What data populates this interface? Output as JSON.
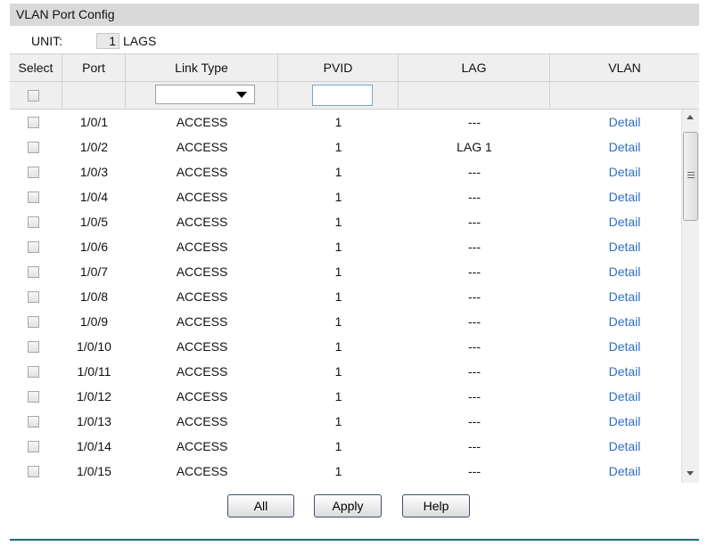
{
  "panel": {
    "title": "VLAN Port Config"
  },
  "unit": {
    "label": "UNIT:",
    "value": "1",
    "lags_label": "LAGS"
  },
  "columns": {
    "select": "Select",
    "port": "Port",
    "link_type": "Link Type",
    "pvid": "PVID",
    "lag": "LAG",
    "vlan": "VLAN"
  },
  "filter": {
    "link_type_value": "",
    "pvid_value": ""
  },
  "rows": [
    {
      "port": "1/0/1",
      "link_type": "ACCESS",
      "pvid": "1",
      "lag": "---",
      "vlan": "Detail"
    },
    {
      "port": "1/0/2",
      "link_type": "ACCESS",
      "pvid": "1",
      "lag": "LAG 1",
      "vlan": "Detail"
    },
    {
      "port": "1/0/3",
      "link_type": "ACCESS",
      "pvid": "1",
      "lag": "---",
      "vlan": "Detail"
    },
    {
      "port": "1/0/4",
      "link_type": "ACCESS",
      "pvid": "1",
      "lag": "---",
      "vlan": "Detail"
    },
    {
      "port": "1/0/5",
      "link_type": "ACCESS",
      "pvid": "1",
      "lag": "---",
      "vlan": "Detail"
    },
    {
      "port": "1/0/6",
      "link_type": "ACCESS",
      "pvid": "1",
      "lag": "---",
      "vlan": "Detail"
    },
    {
      "port": "1/0/7",
      "link_type": "ACCESS",
      "pvid": "1",
      "lag": "---",
      "vlan": "Detail"
    },
    {
      "port": "1/0/8",
      "link_type": "ACCESS",
      "pvid": "1",
      "lag": "---",
      "vlan": "Detail"
    },
    {
      "port": "1/0/9",
      "link_type": "ACCESS",
      "pvid": "1",
      "lag": "---",
      "vlan": "Detail"
    },
    {
      "port": "1/0/10",
      "link_type": "ACCESS",
      "pvid": "1",
      "lag": "---",
      "vlan": "Detail"
    },
    {
      "port": "1/0/11",
      "link_type": "ACCESS",
      "pvid": "1",
      "lag": "---",
      "vlan": "Detail"
    },
    {
      "port": "1/0/12",
      "link_type": "ACCESS",
      "pvid": "1",
      "lag": "---",
      "vlan": "Detail"
    },
    {
      "port": "1/0/13",
      "link_type": "ACCESS",
      "pvid": "1",
      "lag": "---",
      "vlan": "Detail"
    },
    {
      "port": "1/0/14",
      "link_type": "ACCESS",
      "pvid": "1",
      "lag": "---",
      "vlan": "Detail"
    },
    {
      "port": "1/0/15",
      "link_type": "ACCESS",
      "pvid": "1",
      "lag": "---",
      "vlan": "Detail"
    }
  ],
  "buttons": {
    "all": "All",
    "apply": "Apply",
    "help": "Help"
  },
  "colors": {
    "title_bar": "#d9d9d9",
    "header_bg": "#efefef",
    "link": "#2e6dc4",
    "rule": "#1f6b78"
  },
  "icons": {
    "dropdown": "chevron-down-icon",
    "scroll_up": "arrow-up-icon",
    "scroll_down": "arrow-down-icon"
  }
}
